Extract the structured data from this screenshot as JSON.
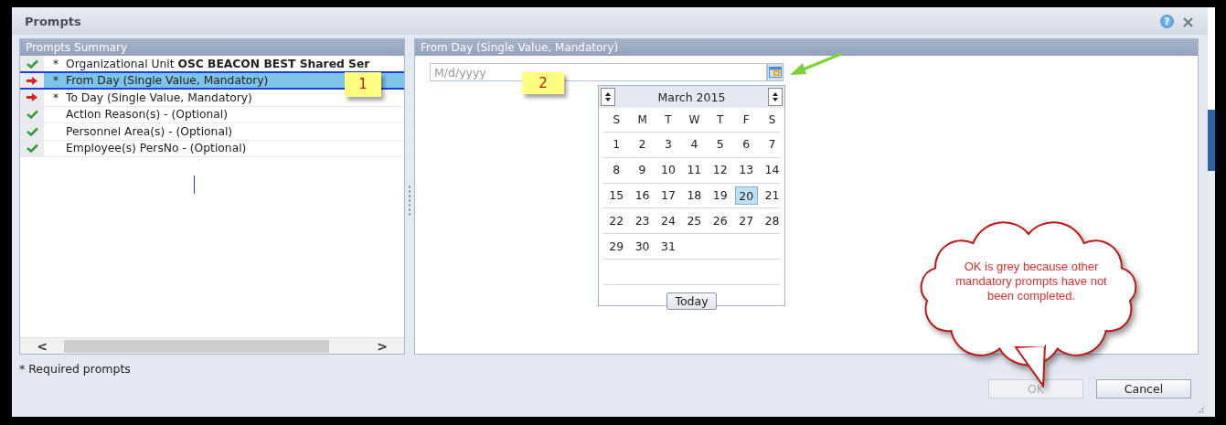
{
  "window": {
    "title": "Prompts",
    "help_glyph": "?",
    "close_glyph": "×"
  },
  "summary": {
    "title": "Prompts Summary",
    "rows": [
      {
        "kind": "check",
        "marker": "*",
        "label": "Organizational Unit **OSC BEACON BEST Shared Ser**",
        "selected": false
      },
      {
        "kind": "arrow",
        "marker": "*",
        "label": "From Day (Single Value, Mandatory)",
        "selected": true
      },
      {
        "kind": "arrow",
        "marker": "*",
        "label": "To Day (Single Value, Mandatory)",
        "selected": false
      },
      {
        "kind": "check",
        "label": "Action Reason(s) - (Optional)",
        "selected": false
      },
      {
        "kind": "check",
        "label": "Personnel Area(s) - (Optional)",
        "selected": false
      },
      {
        "kind": "check",
        "label": "Employee(s) PersNo - (Optional)",
        "selected": false
      }
    ],
    "scroll_left": "<",
    "scroll_right": ">"
  },
  "detail": {
    "title": "From Day (Single Value, Mandatory)",
    "date_field": {
      "placeholder": "M/d/yyyy"
    },
    "calendar": {
      "month": "March 2015",
      "weekdays": [
        "S",
        "M",
        "T",
        "W",
        "T",
        "F",
        "S"
      ],
      "weeks": [
        [
          {
            "day": "1",
            "selected": false
          },
          {
            "day": "2",
            "selected": false
          },
          {
            "day": "3",
            "selected": false
          },
          {
            "day": "4",
            "selected": false
          },
          {
            "day": "5",
            "selected": false
          },
          {
            "day": "6",
            "selected": false
          },
          {
            "day": "7",
            "selected": false
          }
        ],
        [
          {
            "day": "8",
            "selected": false
          },
          {
            "day": "9",
            "selected": false
          },
          {
            "day": "10",
            "selected": false
          },
          {
            "day": "11",
            "selected": false
          },
          {
            "day": "12",
            "selected": false
          },
          {
            "day": "13",
            "selected": false
          },
          {
            "day": "14",
            "selected": false
          }
        ],
        [
          {
            "day": "15",
            "selected": false
          },
          {
            "day": "16",
            "selected": false
          },
          {
            "day": "17",
            "selected": false
          },
          {
            "day": "18",
            "selected": false
          },
          {
            "day": "19",
            "selected": false
          },
          {
            "day": "20",
            "selected": true
          },
          {
            "day": "21",
            "selected": false
          }
        ],
        [
          {
            "day": "22",
            "selected": false
          },
          {
            "day": "23",
            "selected": false
          },
          {
            "day": "24",
            "selected": false
          },
          {
            "day": "25",
            "selected": false
          },
          {
            "day": "26",
            "selected": false
          },
          {
            "day": "27",
            "selected": false
          },
          {
            "day": "28",
            "selected": false
          }
        ],
        [
          {
            "day": "29",
            "selected": false
          },
          {
            "day": "30",
            "selected": false
          },
          {
            "day": "31",
            "selected": false
          }
        ]
      ],
      "today_button": "Today"
    }
  },
  "footer": {
    "note": "* Required prompts",
    "buttons": [
      {
        "label": "OK",
        "disabled": true
      },
      {
        "label": "Cancel",
        "disabled": false
      }
    ]
  },
  "annotations": {
    "step_1": "1",
    "step_2": "2",
    "cloud": "OK is grey because other mandatory prompts have not been completed."
  }
}
